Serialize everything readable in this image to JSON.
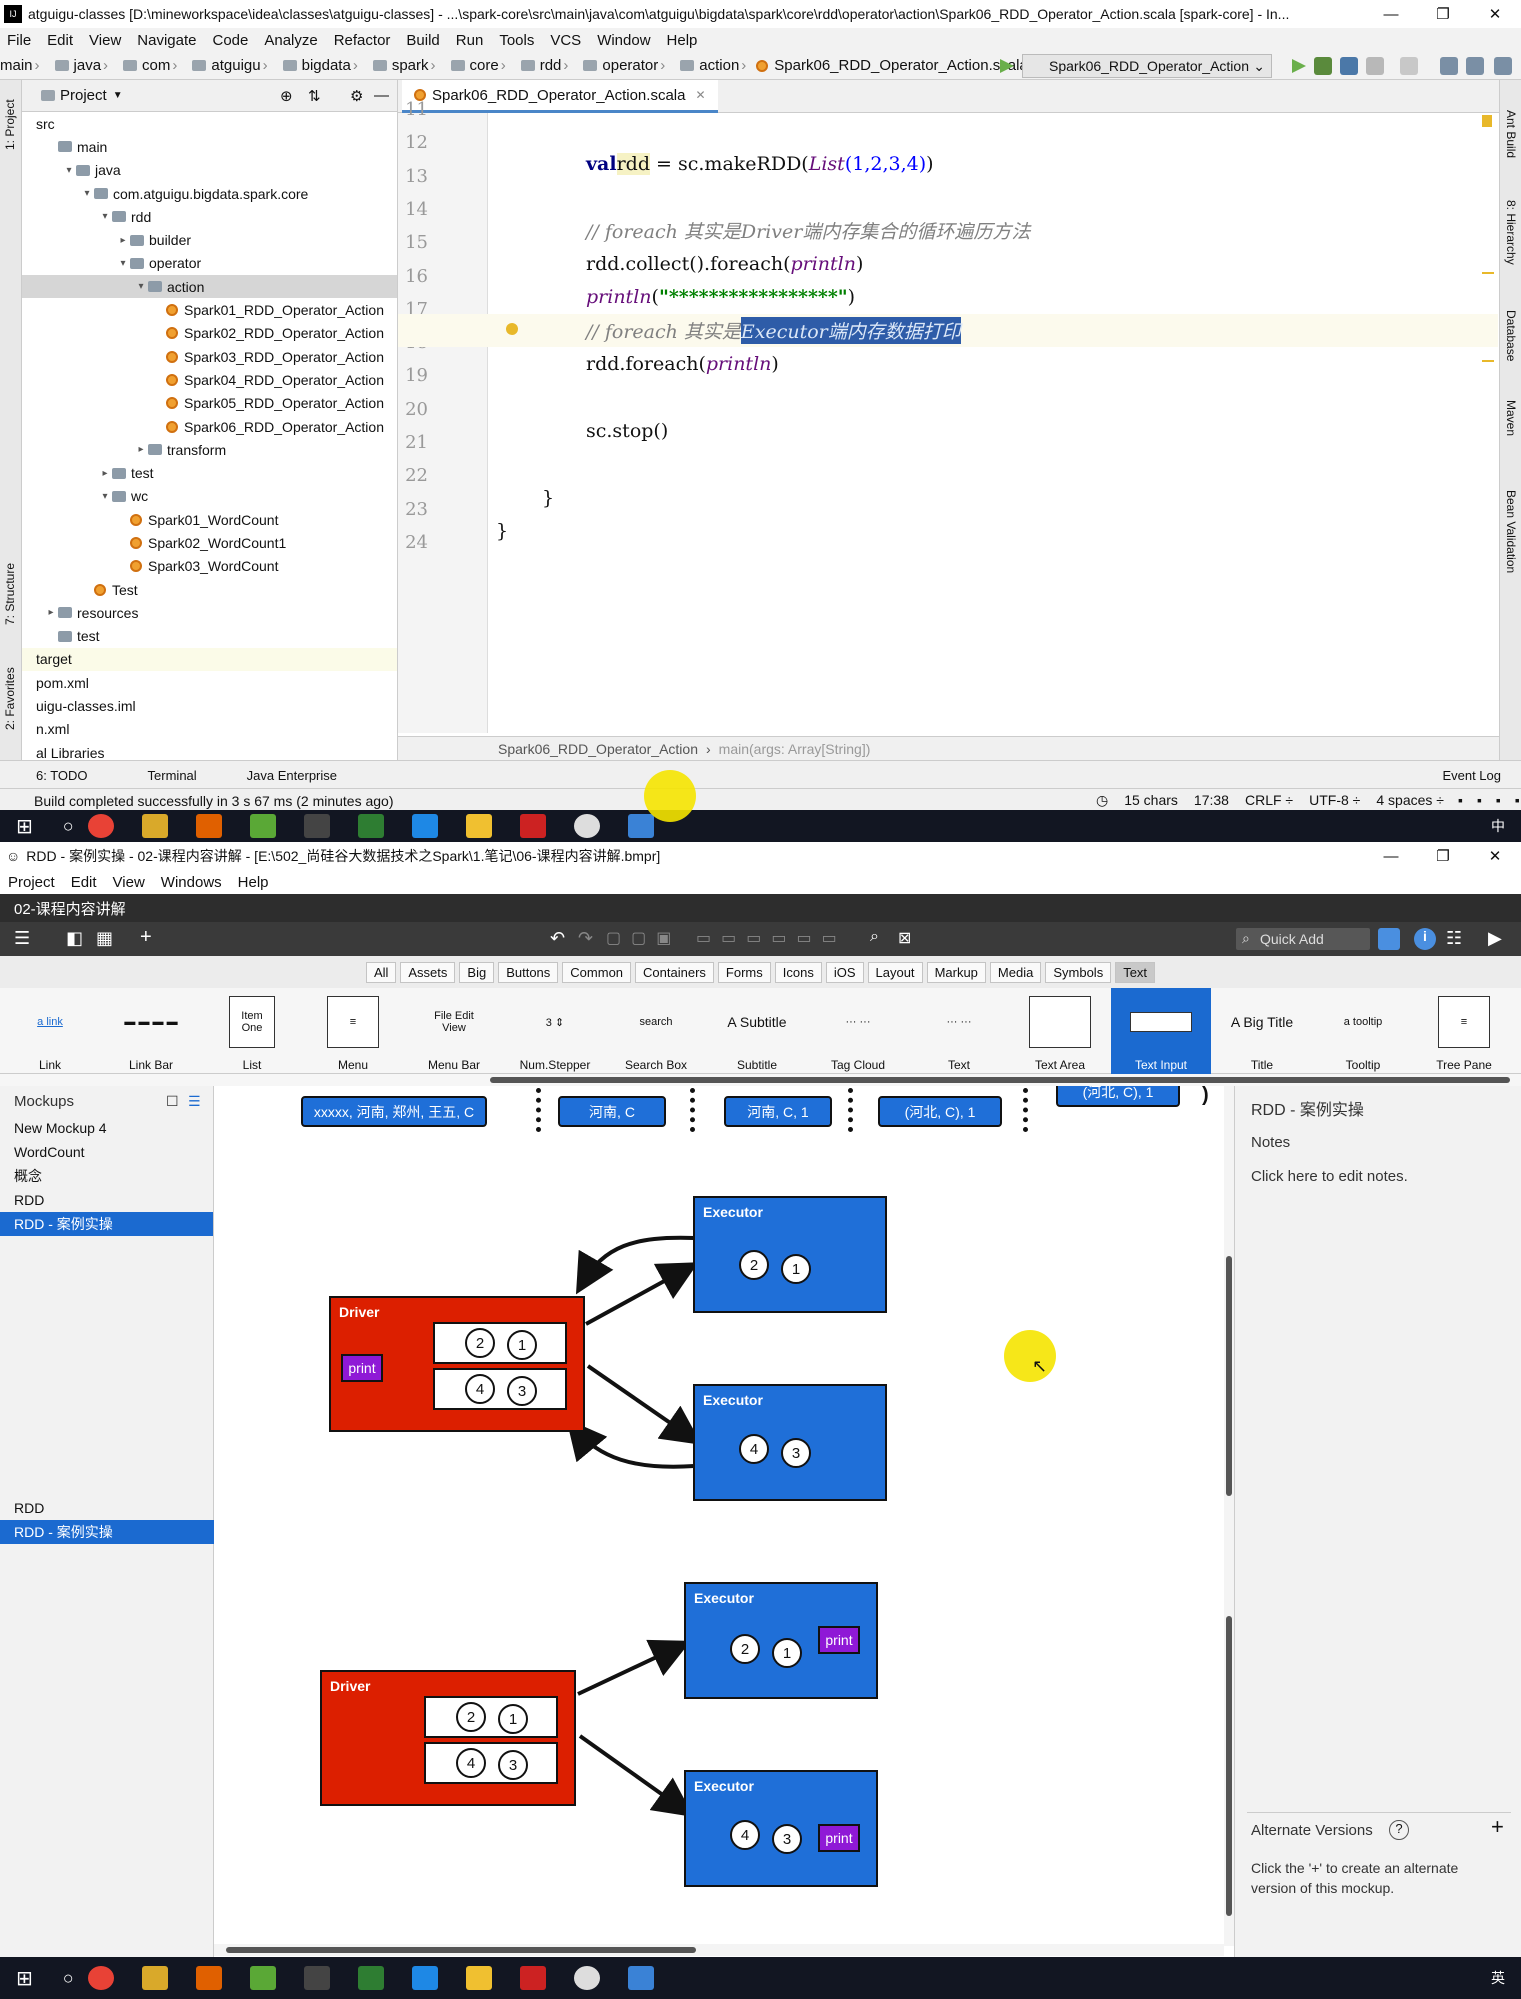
{
  "ide": {
    "title": "atguigu-classes [D:\\mineworkspace\\idea\\classes\\atguigu-classes] - ...\\spark-core\\src\\main\\java\\com\\atguigu\\bigdata\\spark\\core\\rdd\\operator\\action\\Spark06_RDD_Operator_Action.scala [spark-core] - In...",
    "menu": [
      "File",
      "Edit",
      "View",
      "Navigate",
      "Code",
      "Analyze",
      "Refactor",
      "Build",
      "Run",
      "Tools",
      "VCS",
      "Window",
      "Help"
    ],
    "breadcrumbs": [
      "main",
      "java",
      "com",
      "atguigu",
      "bigdata",
      "spark",
      "core",
      "rdd",
      "operator",
      "action",
      "Spark06_RDD_Operator_Action.scala"
    ],
    "run_config": "Spark06_RDD_Operator_Action",
    "left_tabs": [
      "1: Project",
      "7: Structure",
      "2: Favorites"
    ],
    "right_tabs": [
      "Ant Build",
      "8: Hierarchy",
      "Database",
      "Maven",
      "Bean Validation"
    ],
    "project_header": "Project",
    "tree": [
      {
        "label": "src",
        "indent": 0,
        "type": "none"
      },
      {
        "label": "main",
        "indent": 1,
        "type": "folder"
      },
      {
        "label": "java",
        "indent": 2,
        "type": "folder",
        "arrow": "▾"
      },
      {
        "label": "com.atguigu.bigdata.spark.core",
        "indent": 3,
        "type": "folder",
        "arrow": "▾"
      },
      {
        "label": "rdd",
        "indent": 4,
        "type": "folder",
        "arrow": "▾"
      },
      {
        "label": "builder",
        "indent": 5,
        "type": "folder",
        "arrow": "▸"
      },
      {
        "label": "operator",
        "indent": 5,
        "type": "folder",
        "arrow": "▾"
      },
      {
        "label": "action",
        "indent": 6,
        "type": "folder",
        "arrow": "▾",
        "selected": true
      },
      {
        "label": "Spark01_RDD_Operator_Action",
        "indent": 7,
        "type": "class"
      },
      {
        "label": "Spark02_RDD_Operator_Action",
        "indent": 7,
        "type": "class"
      },
      {
        "label": "Spark03_RDD_Operator_Action",
        "indent": 7,
        "type": "class"
      },
      {
        "label": "Spark04_RDD_Operator_Action",
        "indent": 7,
        "type": "class"
      },
      {
        "label": "Spark05_RDD_Operator_Action",
        "indent": 7,
        "type": "class"
      },
      {
        "label": "Spark06_RDD_Operator_Action",
        "indent": 7,
        "type": "class"
      },
      {
        "label": "transform",
        "indent": 6,
        "type": "folder",
        "arrow": "▸"
      },
      {
        "label": "test",
        "indent": 4,
        "type": "folder",
        "arrow": "▸"
      },
      {
        "label": "wc",
        "indent": 4,
        "type": "folder",
        "arrow": "▾"
      },
      {
        "label": "Spark01_WordCount",
        "indent": 5,
        "type": "class"
      },
      {
        "label": "Spark02_WordCount1",
        "indent": 5,
        "type": "class"
      },
      {
        "label": "Spark03_WordCount",
        "indent": 5,
        "type": "class"
      },
      {
        "label": "Test",
        "indent": 3,
        "type": "class"
      },
      {
        "label": "resources",
        "indent": 1,
        "type": "folder",
        "arrow": "▸"
      },
      {
        "label": "test",
        "indent": 1,
        "type": "folder"
      },
      {
        "label": "target",
        "indent": 0,
        "type": "none",
        "highlight": true
      },
      {
        "label": "pom.xml",
        "indent": 0,
        "type": "file"
      },
      {
        "label": "uigu-classes.iml",
        "indent": 0,
        "type": "file"
      },
      {
        "label": "n.xml",
        "indent": 0,
        "type": "file"
      },
      {
        "label": "al Libraries",
        "indent": 0,
        "type": "file"
      }
    ],
    "tab_label": "Spark06_RDD_Operator_Action.scala",
    "line_numbers": [
      "11",
      "12",
      "13",
      "14",
      "15",
      "16",
      "17",
      "18",
      "19",
      "20",
      "21",
      "22",
      "23",
      "24"
    ],
    "code": {
      "l12_kw": "val",
      "l12_var": "rdd",
      "l12_mid": " = sc.makeRDD(",
      "l12_fn": "List",
      "l12_args": "(1,2,3,4)",
      "l12_end": ")",
      "l14": "// foreach 其实是Driver端内存集合的循环遍历方法",
      "l15_a": "rdd.collect().foreach(",
      "l15_fn": "println",
      "l15_b": ")",
      "l16_fn": "println",
      "l16_a": "(",
      "l16_str": "\"*****************\"",
      "l16_b": ")",
      "l17_a": "// foreach 其实是",
      "l17_sel": "Executor端内存数据打印",
      "l18_a": "rdd.foreach(",
      "l18_fn": "println",
      "l18_b": ")",
      "l20": "sc.stop()",
      "l22": "}",
      "l23": "}"
    },
    "breadcrumb_bottom": [
      "Spark06_RDD_Operator_Action",
      "main(args: Array[String])"
    ],
    "toolwindows": [
      "6: TODO",
      "Terminal",
      "Java Enterprise"
    ],
    "event_log": "Event Log",
    "status_msg": "Build completed successfully in 3 s 67 ms (2 minutes ago)",
    "status_right": [
      "15 chars",
      "17:38",
      "CRLF ÷",
      "UTF-8 ÷",
      "4 spaces ÷"
    ]
  },
  "taskbar": {
    "lang": "中",
    "lang2": "英"
  },
  "bal": {
    "title": "RDD - 案例实操 - 02-课程内容讲解 - [E:\\502_尚硅谷大数据技术之Spark\\1.笔记\\06-课程内容讲解.bmpr]",
    "menu": [
      "Project",
      "Edit",
      "View",
      "Windows",
      "Help"
    ],
    "header": "02-课程内容讲解",
    "quick_add": "Quick Add",
    "categories": [
      "All",
      "Assets",
      "Big",
      "Buttons",
      "Common",
      "Containers",
      "Forms",
      "Icons",
      "iOS",
      "Layout",
      "Markup",
      "Media",
      "Symbols",
      "Text"
    ],
    "library": [
      {
        "label": "Link",
        "thumb": "a link"
      },
      {
        "label": "Link Bar",
        "thumb": "▬ ▬ ▬ ▬"
      },
      {
        "label": "List",
        "thumb": "Item One"
      },
      {
        "label": "Menu",
        "thumb": "≡"
      },
      {
        "label": "Menu Bar",
        "thumb": "File Edit View"
      },
      {
        "label": "Num.Stepper",
        "thumb": "3 ⇕"
      },
      {
        "label": "Search Box",
        "thumb": "search"
      },
      {
        "label": "Subtitle",
        "thumb": "A Subtitle"
      },
      {
        "label": "Tag Cloud",
        "thumb": "··· ···"
      },
      {
        "label": "Text",
        "thumb": "··· ···"
      },
      {
        "label": "Text Area",
        "thumb": ""
      },
      {
        "label": "Text Input",
        "thumb": ""
      },
      {
        "label": "Title",
        "thumb": "A Big Title"
      },
      {
        "label": "Tooltip",
        "thumb": "a tooltip"
      },
      {
        "label": "Tree Pane",
        "thumb": "≡"
      }
    ],
    "mockups_header": "Mockups",
    "mockups": [
      "New Mockup 4",
      "WordCount",
      "概念",
      "RDD",
      "RDD - 案例实操"
    ],
    "mockups2": [
      "RDD",
      "RDD - 案例实操"
    ],
    "pills": [
      "xxxxx, 河南, 郑州, 王五, C",
      "河南, C",
      "河南, C, 1",
      "(河北, C), 1",
      "(河北, C), 1"
    ],
    "driver": "Driver",
    "executor": "Executor",
    "print": "print",
    "nums": {
      "one": "1",
      "two": "2",
      "three": "3",
      "four": "4"
    },
    "notes_title": "RDD - 案例实操",
    "notes_label": "Notes",
    "notes_text": "Click here to edit notes.",
    "alt_title": "Alternate Versions",
    "alt_text": "Click the '+' to create an alternate version of this mockup."
  }
}
